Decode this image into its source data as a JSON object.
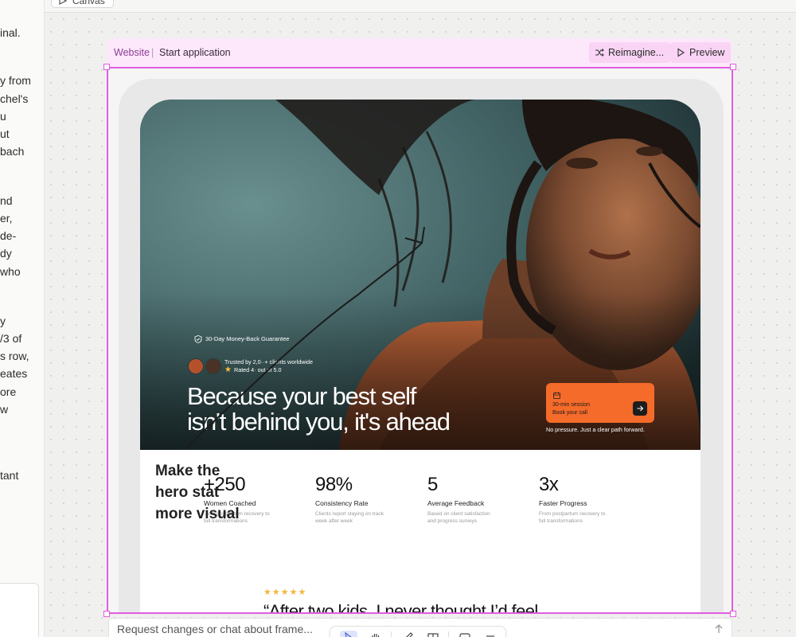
{
  "left_panel": {
    "lines": [
      "inal.",
      "y from",
      "chel's",
      "u",
      "ut",
      "bach",
      "nd",
      "er,",
      "de-",
      "dy",
      "who",
      "y",
      "/3 of",
      "s row,",
      "eates",
      "ore",
      "w",
      "tant"
    ]
  },
  "canvas_tab": {
    "label": "Canvas"
  },
  "frame_header": {
    "site": "Website",
    "separator": "|",
    "page": "Start application",
    "reimagine_label": "Reimagine...",
    "preview_label": "Preview"
  },
  "hero": {
    "guarantee": "30-Day Money-Back Guarantee",
    "trust": "Trusted by 2,0··+ clients worldwide",
    "rating": "Rated 4· out of 5.0",
    "headline_line1": "Because your best self",
    "headline_line2": "isn't behind you, it's ahead",
    "cta_session": "30-min session",
    "cta_book": "Book your call",
    "cta_note": "No pressure. Just a clear path forward."
  },
  "stats": [
    {
      "value": "+250",
      "label": "Women Coached",
      "desc1": "...om postpartum recovery to",
      "desc2": "full transformations"
    },
    {
      "value": "98%",
      "label": "Consistency Rate",
      "desc1": "Clients report staying on track",
      "desc2": "week after week"
    },
    {
      "value": "5",
      "label": "Average Feedback",
      "desc1": "Based on client satisfaction",
      "desc2": "and progress surveys"
    },
    {
      "value": "3x",
      "label": "Faster Progress",
      "desc1": "From postpartum recovery to",
      "desc2": "full transformations"
    }
  ],
  "testimonial": {
    "stars": "★★★★★",
    "quote": "“After two kids, I never thought I’d feel"
  },
  "annotation": {
    "text": "Make the hero stat more visual"
  },
  "chat": {
    "placeholder": "Request changes or chat about frame..."
  },
  "colors": {
    "selection": "#e05ce0",
    "header_bg": "#fde7fb",
    "cta": "#f56b2a",
    "stars": "#f2b63a",
    "tool_active": "#dfe4fb"
  },
  "icons": {
    "shuffle": "reimagine-icon",
    "play": "preview-icon",
    "shield": "shield-icon",
    "calendar": "calendar-icon",
    "arrow": "arrow-right-icon",
    "send": "send-icon"
  }
}
